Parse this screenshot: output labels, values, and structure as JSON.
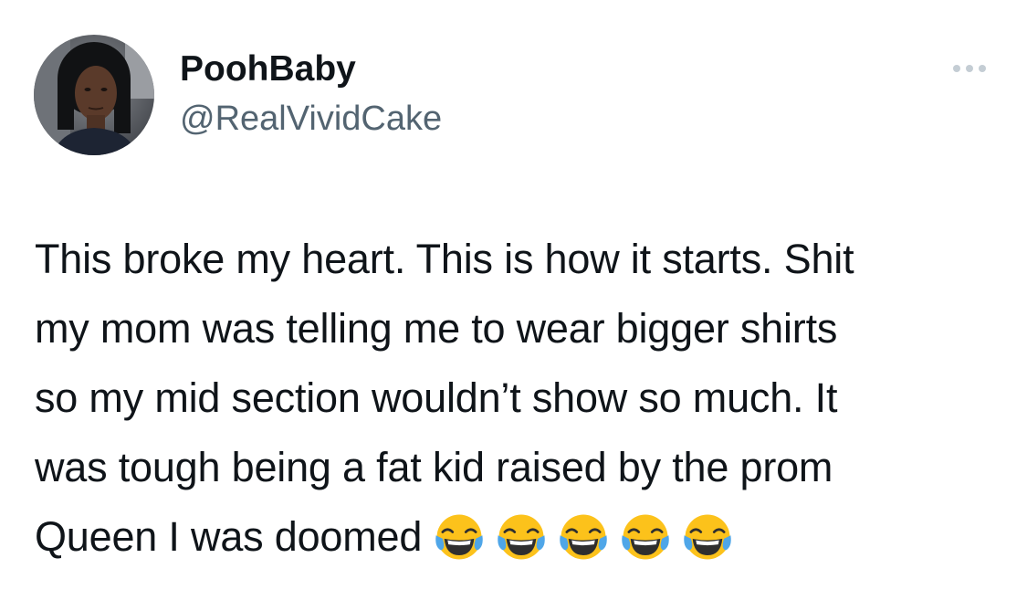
{
  "user": {
    "display_name": "PoohBaby",
    "handle": "@RealVividCake"
  },
  "menu": {
    "icon": "more-horizontal-icon"
  },
  "tweet": {
    "lines": [
      "This broke my heart. This is how it starts. Shit",
      "my mom was telling me to wear bigger shirts",
      "so my mid section wouldn’t show so much. It",
      "was tough being a fat kid raised by the prom",
      "Queen I was doomed"
    ],
    "emojis": [
      "face-with-tears-of-joy",
      "face-with-tears-of-joy",
      "face-with-tears-of-joy",
      "face-with-tears-of-joy",
      "face-with-tears-of-joy"
    ]
  },
  "colors": {
    "text": "#0f1419",
    "secondary": "#536471",
    "dots": "#c4cdd4",
    "emoji_face": "#fcc21b"
  }
}
